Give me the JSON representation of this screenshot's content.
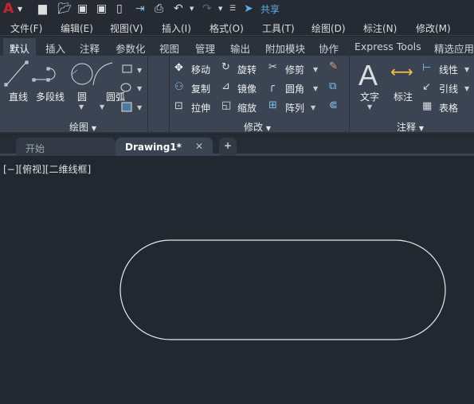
{
  "quick_access": {
    "share_label": "共享",
    "icons": [
      "autocad-logo",
      "new",
      "open",
      "save",
      "save-as",
      "open-web",
      "publish",
      "plot",
      "undo",
      "redo",
      "customize"
    ]
  },
  "menu": [
    "文件(F)",
    "编辑(E)",
    "视图(V)",
    "插入(I)",
    "格式(O)",
    "工具(T)",
    "绘图(D)",
    "标注(N)",
    "修改(M)"
  ],
  "ribbon_tabs": [
    "默认",
    "插入",
    "注释",
    "参数化",
    "视图",
    "管理",
    "输出",
    "附加模块",
    "协作",
    "Express Tools",
    "精选应用"
  ],
  "draw": {
    "title": "绘图",
    "line": "直线",
    "polyline": "多段线",
    "circle": "圆",
    "arc": "圆弧"
  },
  "modify": {
    "title": "修改",
    "move": "移动",
    "rotate": "旋转",
    "trim": "修剪",
    "copy": "复制",
    "mirror": "镜像",
    "fillet": "圆角",
    "stretch": "拉伸",
    "scale": "缩放",
    "array": "阵列"
  },
  "annotation": {
    "title": "注释",
    "text": "文字",
    "dimension": "标注",
    "linear": "线性",
    "leader": "引线",
    "table": "表格"
  },
  "file_tabs": {
    "start": "开始",
    "drawing": "Drawing1*"
  },
  "viewport_label": "[−][俯视][二维线框]",
  "colors": {
    "accent": "#5aaeea",
    "canvas": "#212830",
    "ribbon": "#3b4453",
    "logo": "#c8252c"
  }
}
